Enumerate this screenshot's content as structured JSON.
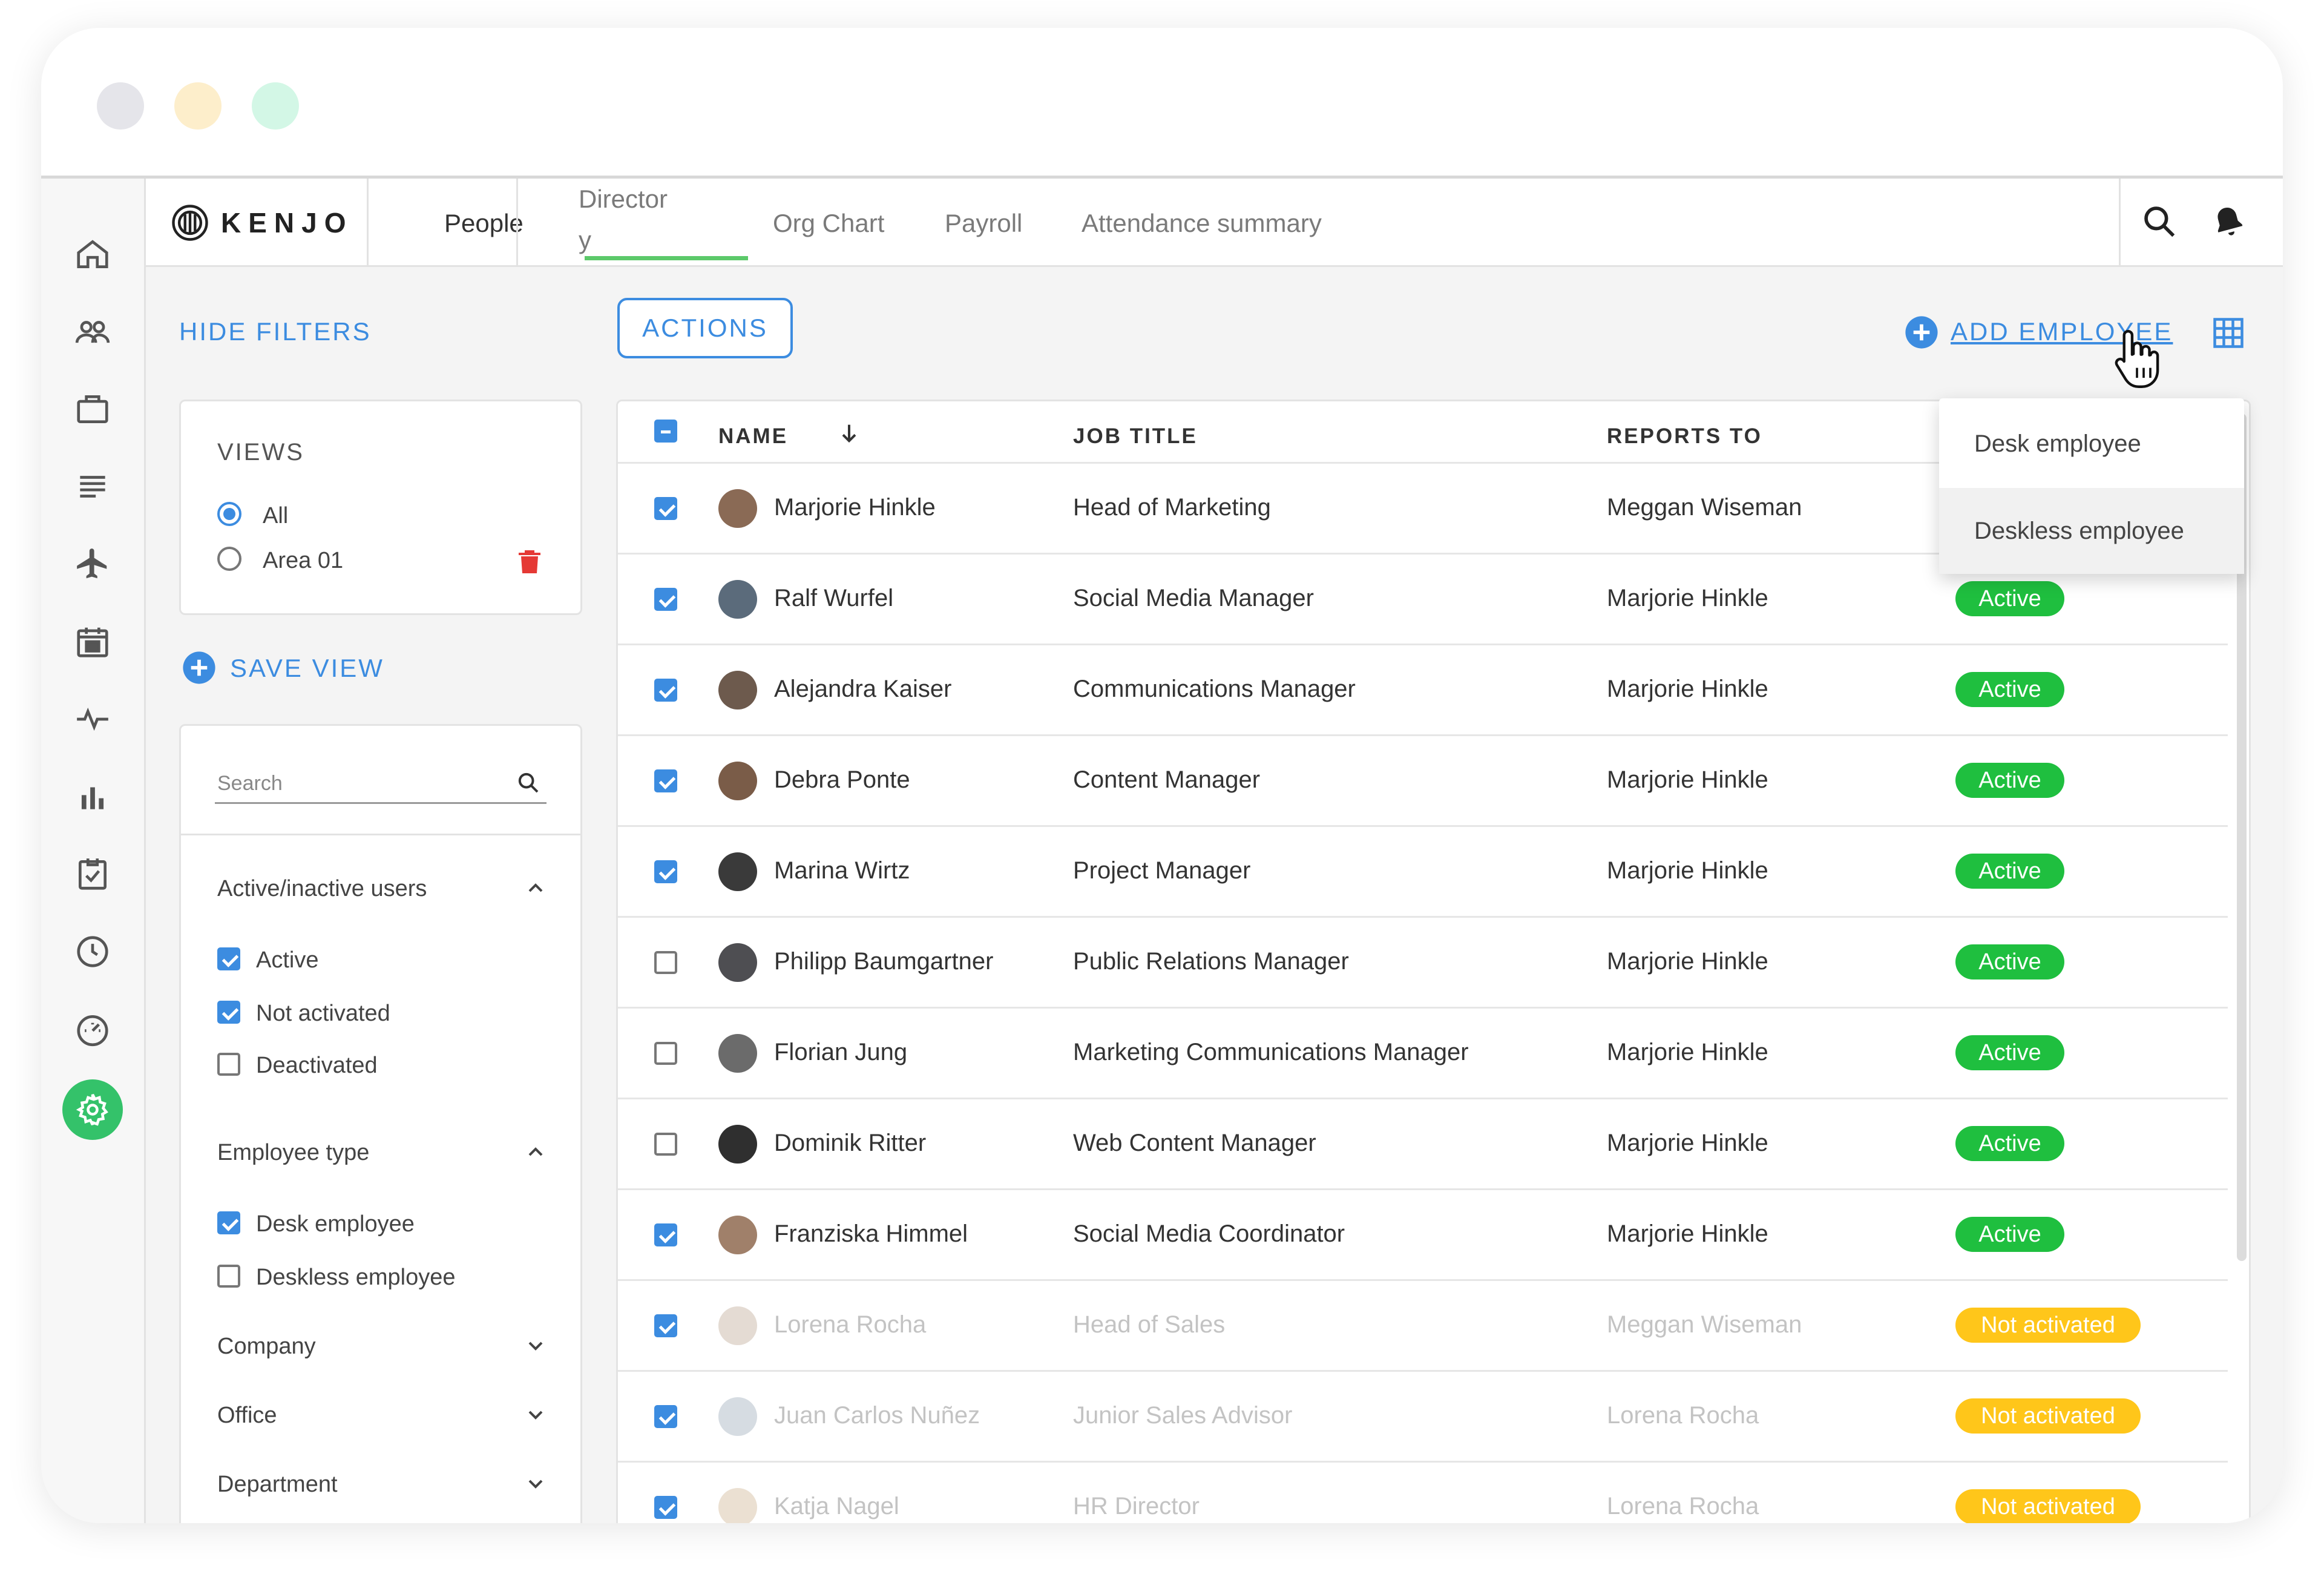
{
  "window_controls": {
    "colors": [
      "#e5e5ea",
      "#fdeecb",
      "#d3f7e6"
    ]
  },
  "brand": {
    "name": "KENJO"
  },
  "nav_tabs": [
    {
      "label": "People"
    },
    {
      "label": "Director\ny",
      "line1": "Director",
      "line2": "y"
    },
    {
      "label": "Org Chart"
    },
    {
      "label": "Payroll"
    },
    {
      "label": "Attendance summary"
    }
  ],
  "header_icons": [
    "search-icon",
    "bell-icon",
    "chevron-down-icon"
  ],
  "rail_icons": [
    "home-icon",
    "people-icon",
    "briefcase-icon",
    "list-icon",
    "plane-icon",
    "calendar-icon",
    "pulse-icon",
    "bar-chart-icon",
    "checklist-icon",
    "clock-icon",
    "gauge-icon",
    "settings-icon"
  ],
  "toolbar": {
    "hide_filters": "HIDE FILTERS",
    "actions": "ACTIONS",
    "add_employee": "ADD EMPLOYEE"
  },
  "views": {
    "title": "VIEWS",
    "items": [
      {
        "label": "All",
        "selected": true
      },
      {
        "label": "Area 01",
        "selected": false
      }
    ],
    "save_view": "SAVE VIEW"
  },
  "filters": {
    "search_placeholder": "Search",
    "sections": [
      {
        "title": "Active/inactive users",
        "expanded": true,
        "options": [
          {
            "label": "Active",
            "checked": true
          },
          {
            "label": "Not activated",
            "checked": true
          },
          {
            "label": "Deactivated",
            "checked": false
          }
        ]
      },
      {
        "title": "Employee type",
        "expanded": true,
        "options": [
          {
            "label": "Desk employee",
            "checked": true
          },
          {
            "label": "Deskless employee",
            "checked": false
          }
        ]
      },
      {
        "title": "Company",
        "expanded": false
      },
      {
        "title": "Office",
        "expanded": false
      },
      {
        "title": "Department",
        "expanded": false
      }
    ]
  },
  "table": {
    "columns": [
      "NAME",
      "JOB TITLE",
      "REPORTS TO"
    ],
    "rows": [
      {
        "name": "Marjorie Hinkle",
        "job": "Head of Marketing",
        "reports": "Meggan Wiseman",
        "status": "",
        "checked": true,
        "dim": false
      },
      {
        "name": "Ralf Wurfel",
        "job": "Social Media Manager",
        "reports": "Marjorie Hinkle",
        "status": "Active",
        "checked": true,
        "dim": false
      },
      {
        "name": "Alejandra Kaiser",
        "job": "Communications Manager",
        "reports": "Marjorie Hinkle",
        "status": "Active",
        "checked": true,
        "dim": false
      },
      {
        "name": "Debra Ponte",
        "job": "Content Manager",
        "reports": "Marjorie Hinkle",
        "status": "Active",
        "checked": true,
        "dim": false
      },
      {
        "name": "Marina Wirtz",
        "job": "Project Manager",
        "reports": "Marjorie Hinkle",
        "status": "Active",
        "checked": true,
        "dim": false
      },
      {
        "name": "Philipp Baumgartner",
        "job": "Public Relations Manager",
        "reports": "Marjorie Hinkle",
        "status": "Active",
        "checked": false,
        "dim": false
      },
      {
        "name": "Florian Jung",
        "job": "Marketing Communications Manager",
        "reports": "Marjorie Hinkle",
        "status": "Active",
        "checked": false,
        "dim": false
      },
      {
        "name": "Dominik Ritter",
        "job": "Web Content Manager",
        "reports": "Marjorie Hinkle",
        "status": "Active",
        "checked": false,
        "dim": false
      },
      {
        "name": "Franziska Himmel",
        "job": "Social Media Coordinator",
        "reports": "Marjorie Hinkle",
        "status": "Active",
        "checked": true,
        "dim": false
      },
      {
        "name": "Lorena Rocha",
        "job": "Head of Sales",
        "reports": "Meggan Wiseman",
        "status": "Not activated",
        "checked": true,
        "dim": true
      },
      {
        "name": "Juan Carlos Nuñez",
        "job": "Junior Sales Advisor",
        "reports": "Lorena Rocha",
        "status": "Not activated",
        "checked": true,
        "dim": true
      },
      {
        "name": "Katja Nagel",
        "job": "HR Director",
        "reports": "Lorena Rocha",
        "status": "Not activated",
        "checked": true,
        "dim": true
      }
    ]
  },
  "add_menu": {
    "items": [
      {
        "label": "Desk employee",
        "highlighted": false
      },
      {
        "label": "Deskless employee",
        "highlighted": true
      }
    ]
  },
  "colors": {
    "accent": "#3c8ce0",
    "active": "#1fbf3f",
    "not_activated": "#ffc61a",
    "settings": "#34c26a",
    "danger": "#e53935"
  }
}
